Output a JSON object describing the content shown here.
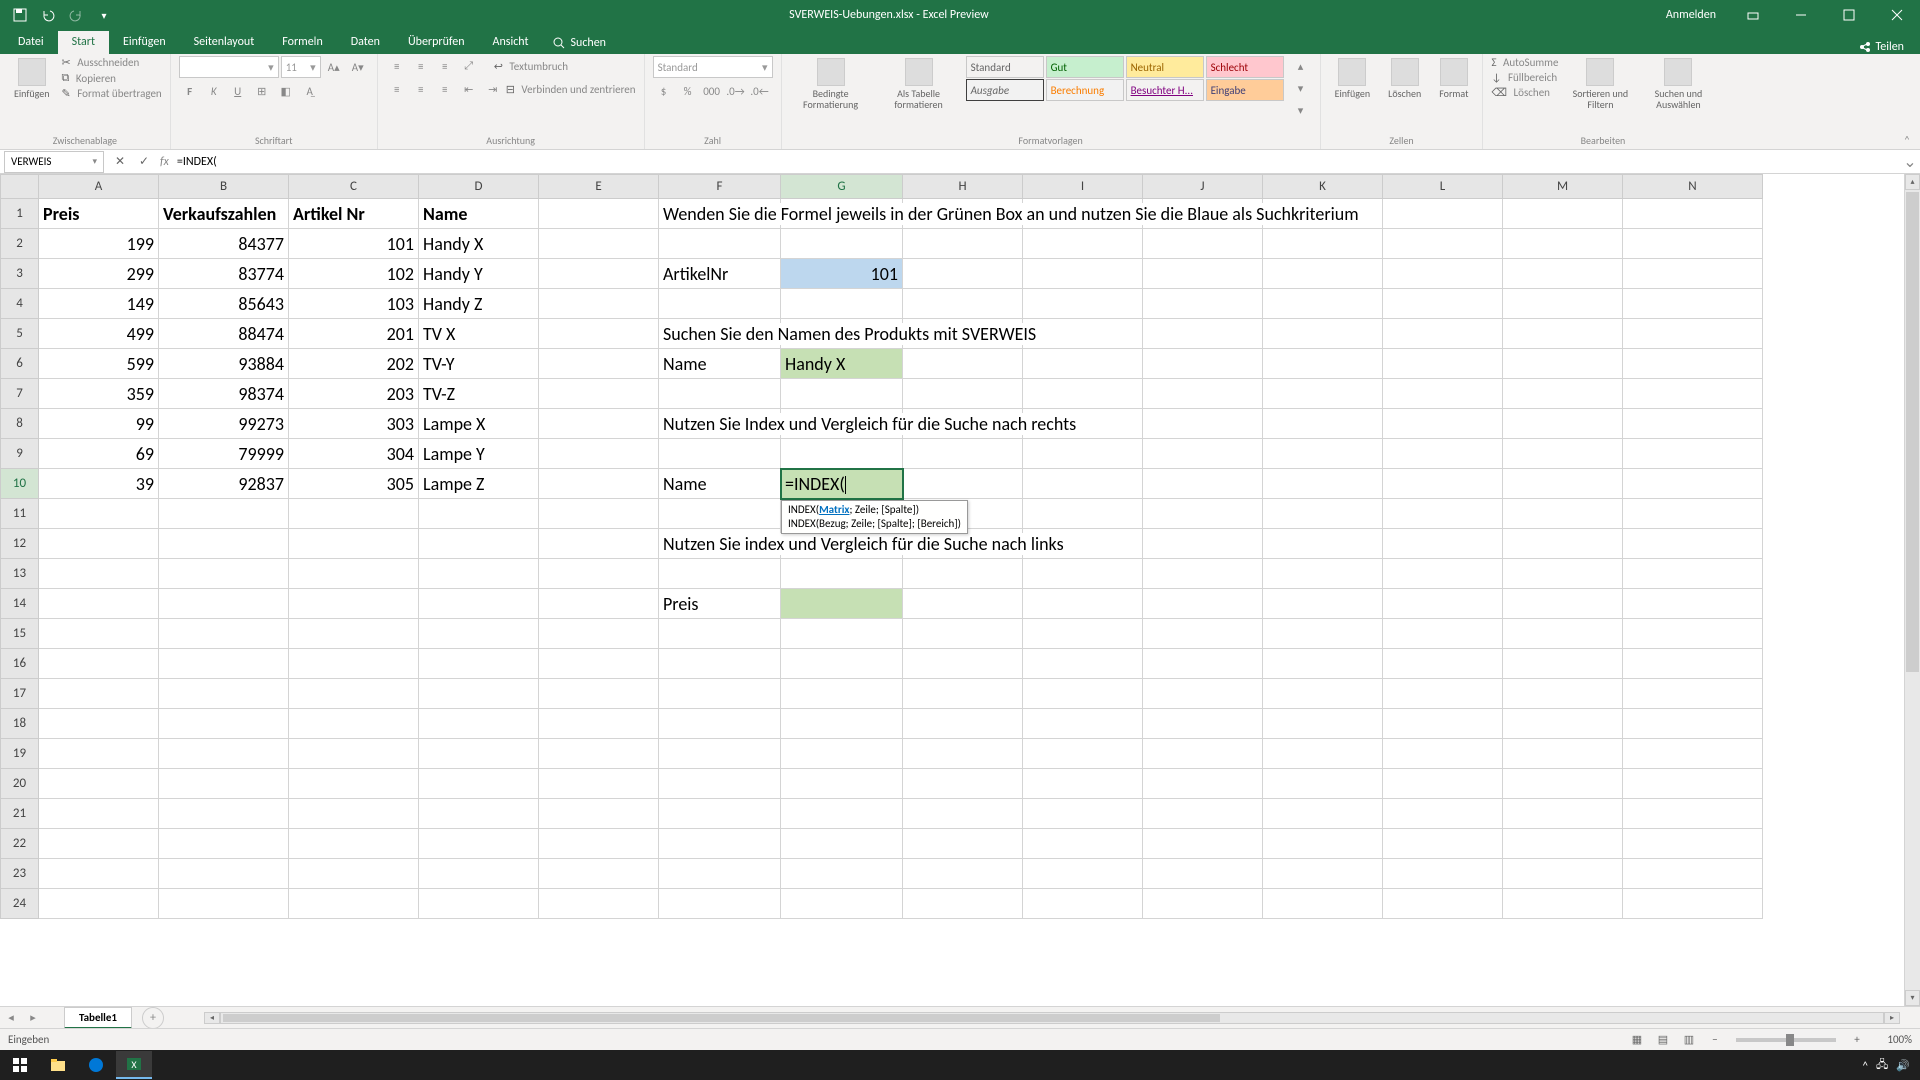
{
  "titlebar": {
    "title": "SVERWEIS-Uebungen.xlsx - Excel Preview",
    "account": "Anmelden"
  },
  "ribbon_tabs": {
    "file": "Datei",
    "home": "Start",
    "insert": "Einfügen",
    "page_layout": "Seitenlayout",
    "formulas": "Formeln",
    "data": "Daten",
    "review": "Überprüfen",
    "view": "Ansicht",
    "search": "Suchen",
    "share": "Teilen"
  },
  "ribbon": {
    "clipboard": {
      "paste": "Einfügen",
      "cut": "Ausschneiden",
      "copy": "Kopieren",
      "format_painter": "Format übertragen",
      "label": "Zwischenablage"
    },
    "font": {
      "font_name": "",
      "font_size": "11",
      "label": "Schriftart",
      "bold": "F",
      "italic": "K",
      "underline": "U"
    },
    "alignment": {
      "wrap": "Textumbruch",
      "merge": "Verbinden und zentrieren",
      "label": "Ausrichtung"
    },
    "number": {
      "format_standard": "Standard",
      "label": "Zahl"
    },
    "styles": {
      "cond_fmt": "Bedingte Formatierung",
      "as_table": "Als Tabelle formatieren",
      "s_standard": "Standard",
      "s_gut": "Gut",
      "s_neutral": "Neutral",
      "s_schlecht": "Schlecht",
      "s_ausgabe": "Ausgabe",
      "s_berechnung": "Berechnung",
      "s_besuchter": "Besuchter H...",
      "s_eingabe": "Eingabe",
      "label": "Formatvorlagen"
    },
    "cells": {
      "insert": "Einfügen",
      "delete": "Löschen",
      "format": "Format",
      "label": "Zellen"
    },
    "editing": {
      "autosum": "AutoSumme",
      "fill": "Füllbereich",
      "clear": "Löschen",
      "sort": "Sortieren und Filtern",
      "find": "Suchen und Auswählen",
      "label": "Bearbeiten"
    }
  },
  "formula_bar": {
    "name_box": "VERWEIS",
    "formula": "=INDEX("
  },
  "columns": [
    "A",
    "B",
    "C",
    "D",
    "E",
    "F",
    "G",
    "H",
    "I",
    "J",
    "K",
    "L",
    "M",
    "N"
  ],
  "row_numbers": [
    1,
    2,
    3,
    4,
    5,
    6,
    7,
    8,
    9,
    10,
    11,
    12,
    13,
    14,
    15,
    16,
    17,
    18,
    19,
    20,
    21,
    22,
    23,
    24
  ],
  "sheet_tab": "Tabelle1",
  "status": {
    "mode": "Eingeben",
    "zoom": "100%"
  },
  "tooltip": {
    "line1_func": "INDEX(",
    "line1_p1": "Matrix",
    "line1_rest": "; Zeile; [Spalte])",
    "line2": "INDEX(Bezug; Zeile; [Spalte]; [Bereich])"
  },
  "cells": {
    "A1": "Preis",
    "B1": "Verkaufszahlen",
    "C1": "Artikel Nr",
    "D1": "Name",
    "F1": "Wenden Sie die Formel jeweils in der Grünen Box an und nutzen Sie die Blaue als Suchkriterium",
    "A2": "199",
    "B2": "84377",
    "C2": "101",
    "D2": "Handy X",
    "A3": "299",
    "B3": "83774",
    "C3": "102",
    "D3": "Handy Y",
    "A4": "149",
    "B4": "85643",
    "C4": "103",
    "D4": "Handy Z",
    "A5": "499",
    "B5": "88474",
    "C5": "201",
    "D5": "TV X",
    "A6": "599",
    "B6": "93884",
    "C6": "202",
    "D6": "TV-Y",
    "A7": "359",
    "B7": "98374",
    "C7": "203",
    "D7": "TV-Z",
    "A8": "99",
    "B8": "99273",
    "C8": "303",
    "D8": "Lampe X",
    "A9": "69",
    "B9": "79999",
    "C9": "304",
    "D9": "Lampe Y",
    "A10": "39",
    "B10": "92837",
    "C10": "305",
    "D10": "Lampe Z",
    "F3": "ArtikelNr",
    "G3": "101",
    "F5": "Suchen Sie den Namen des Produkts mit SVERWEIS",
    "F6": "Name",
    "G6": "Handy X",
    "F8": "Nutzen Sie Index und Vergleich für die Suche nach rechts",
    "F10": "Name",
    "G10": "=INDEX(",
    "F12": "Nutzen Sie index und Vergleich für die Suche nach links",
    "F14": "Preis"
  }
}
